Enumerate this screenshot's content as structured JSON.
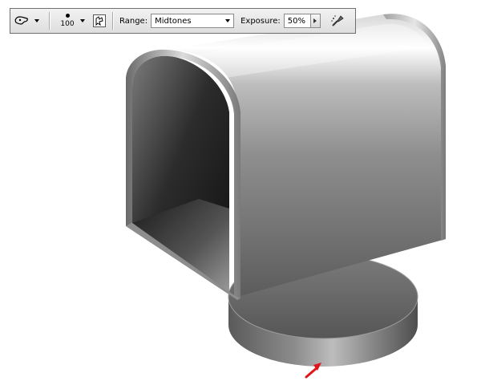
{
  "toolbar": {
    "tool_preset_icon": "sponge-tool-icon",
    "brush_size": "100",
    "brush_panel_icon": "brush-panel-icon",
    "range_label": "Range:",
    "range_value": "Midtones",
    "exposure_label": "Exposure:",
    "exposure_value": "50%",
    "airbrush_icon": "airbrush-icon"
  },
  "canvas": {
    "artwork": "mailbox-illustration",
    "pointer_icon": "red-arrow-icon",
    "pointer_color": "#e0151b"
  }
}
